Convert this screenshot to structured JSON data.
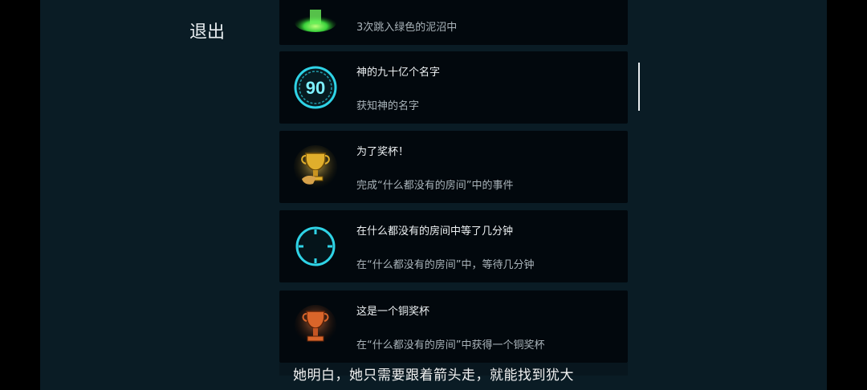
{
  "exit_label": "退出",
  "achievements": [
    {
      "title": "",
      "desc": "3次跳入绿色的泥沼中",
      "icon": "green-swamp-icon"
    },
    {
      "title": "神的九十亿个名字",
      "desc": "获知神的名字",
      "icon": "number-90-icon",
      "badge_text": "90"
    },
    {
      "title": "为了奖杯！",
      "desc": "完成“什么都没有的房间”中的事件",
      "icon": "gold-trophy-icon"
    },
    {
      "title": "在什么都没有的房间中等了几分钟",
      "desc": "在“什么都没有的房间”中，等待几分钟",
      "icon": "clock-icon"
    },
    {
      "title": "这是一个铜奖杯",
      "desc": "在“什么都没有的房间”中获得一个铜奖杯",
      "icon": "bronze-trophy-icon"
    }
  ],
  "subtitle": "她明白，她只需要跟着箭头走，就能找到犹大",
  "colors": {
    "background": "#0a1c25",
    "card": "#02080d",
    "cyan": "#2fd3e6",
    "gold": "#d9a627",
    "bronze": "#d9652a",
    "green": "#3bd23b"
  }
}
